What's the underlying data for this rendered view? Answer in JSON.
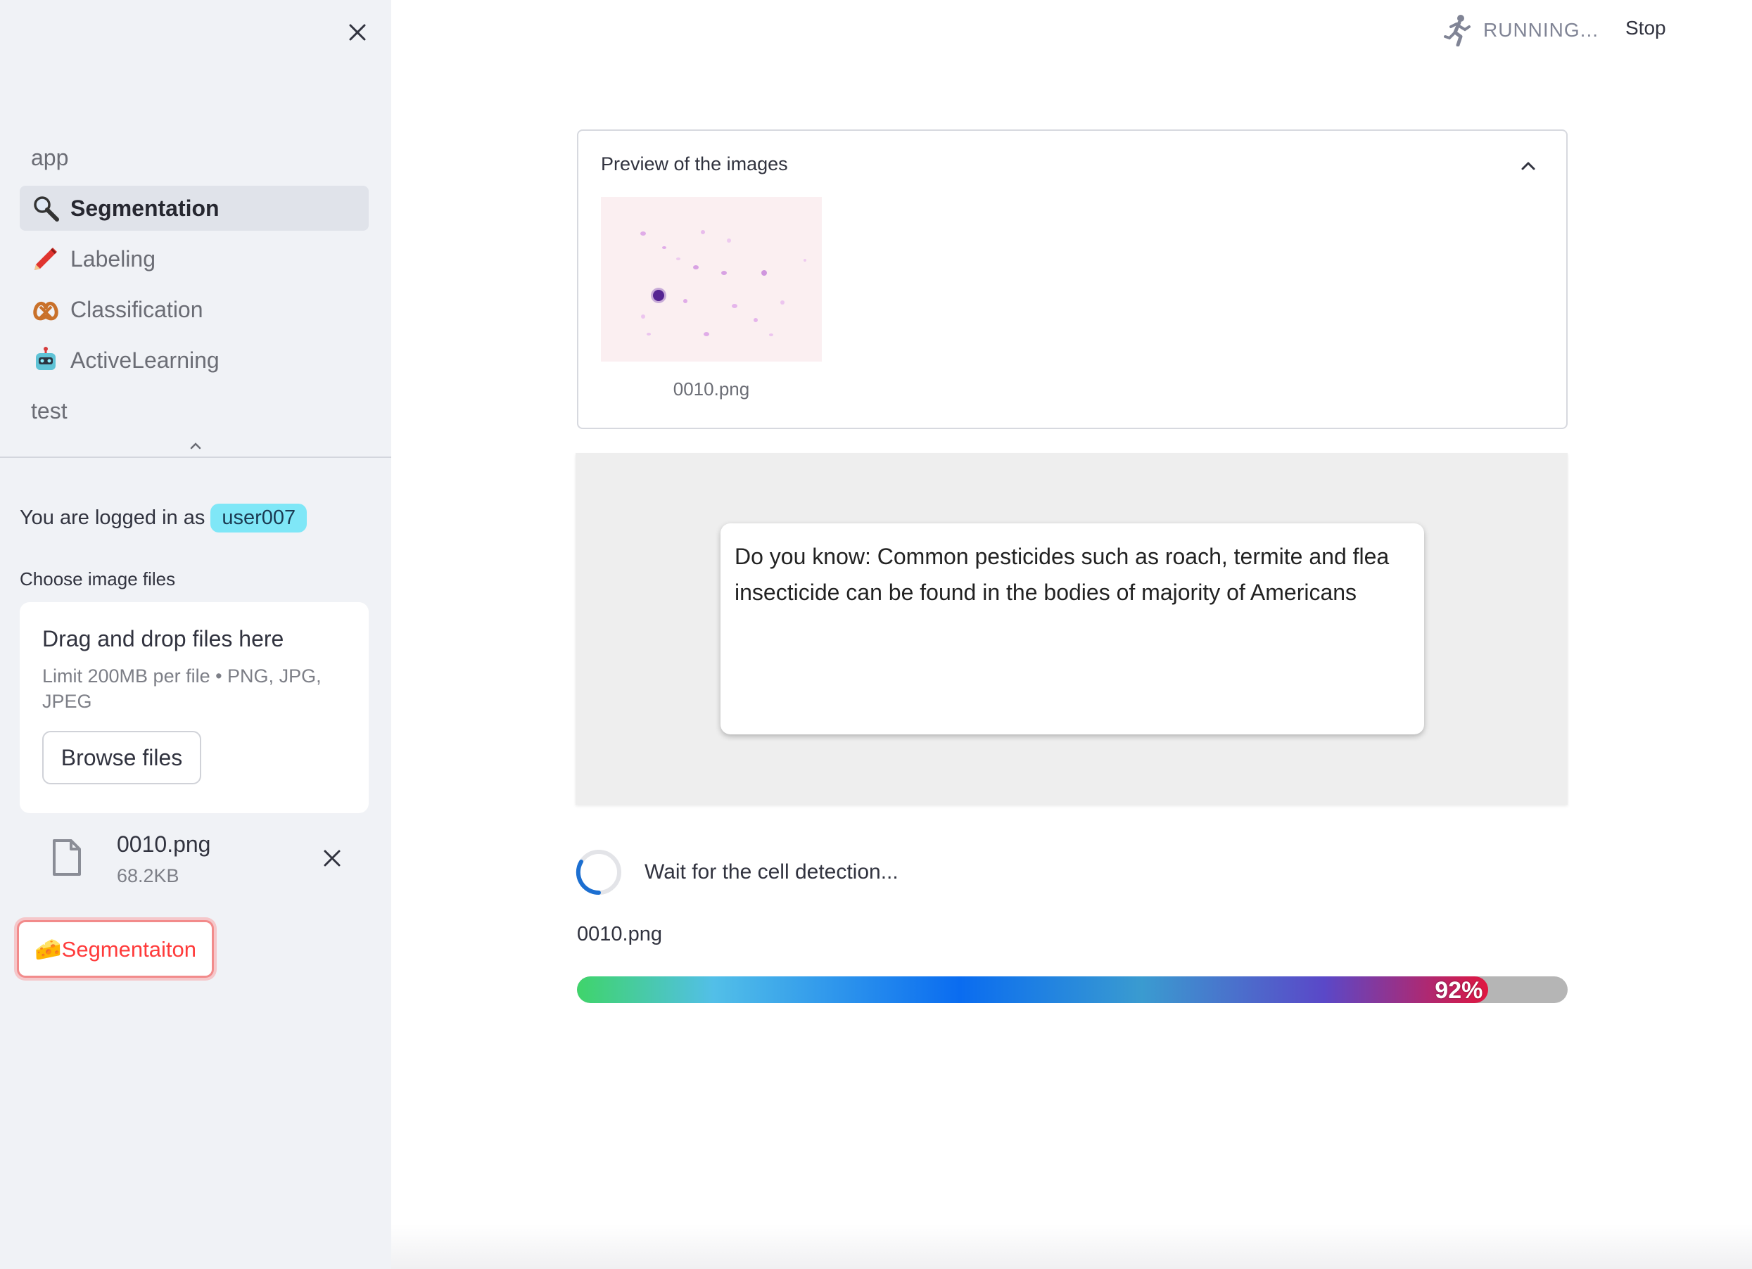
{
  "sidebar": {
    "nav_items": [
      {
        "label": "app",
        "icon": "",
        "active": false
      },
      {
        "label": "Segmentation",
        "icon": "magnifier-icon",
        "active": true
      },
      {
        "label": "Labeling",
        "icon": "pencil-icon",
        "active": false
      },
      {
        "label": "Classification",
        "icon": "pretzel-icon",
        "active": false
      },
      {
        "label": "ActiveLearning",
        "icon": "robot-icon",
        "active": false
      },
      {
        "label": "test",
        "icon": "",
        "active": false
      }
    ],
    "login_prefix": "You are logged in as",
    "username": "user007",
    "uploader": {
      "label": "Choose image files",
      "drop_title": "Drag and drop files here",
      "limit_text": "Limit 200MB per file • PNG, JPG, JPEG",
      "browse_label": "Browse files"
    },
    "uploaded_file": {
      "name": "0010.png",
      "size": "68.2KB"
    },
    "action_button": "🧀Segmentaiton"
  },
  "header": {
    "status_text": "RUNNING...",
    "stop_label": "Stop"
  },
  "main": {
    "preview": {
      "title": "Preview of the images",
      "caption": "0010.png"
    },
    "tip_text": "Do you know: Common pesticides such as roach, termite and flea insecticide can be found in the bodies of majority of Americans",
    "spinner_text": "Wait for the cell detection...",
    "progress": {
      "label": "0010.png",
      "percent": 92,
      "percent_text": "92%"
    }
  },
  "colors": {
    "sidebar_bg": "#f0f2f6",
    "user_badge": "#7fe7f7",
    "action_red": "#ff3b3b",
    "spinner_blue": "#1c6fd1"
  }
}
